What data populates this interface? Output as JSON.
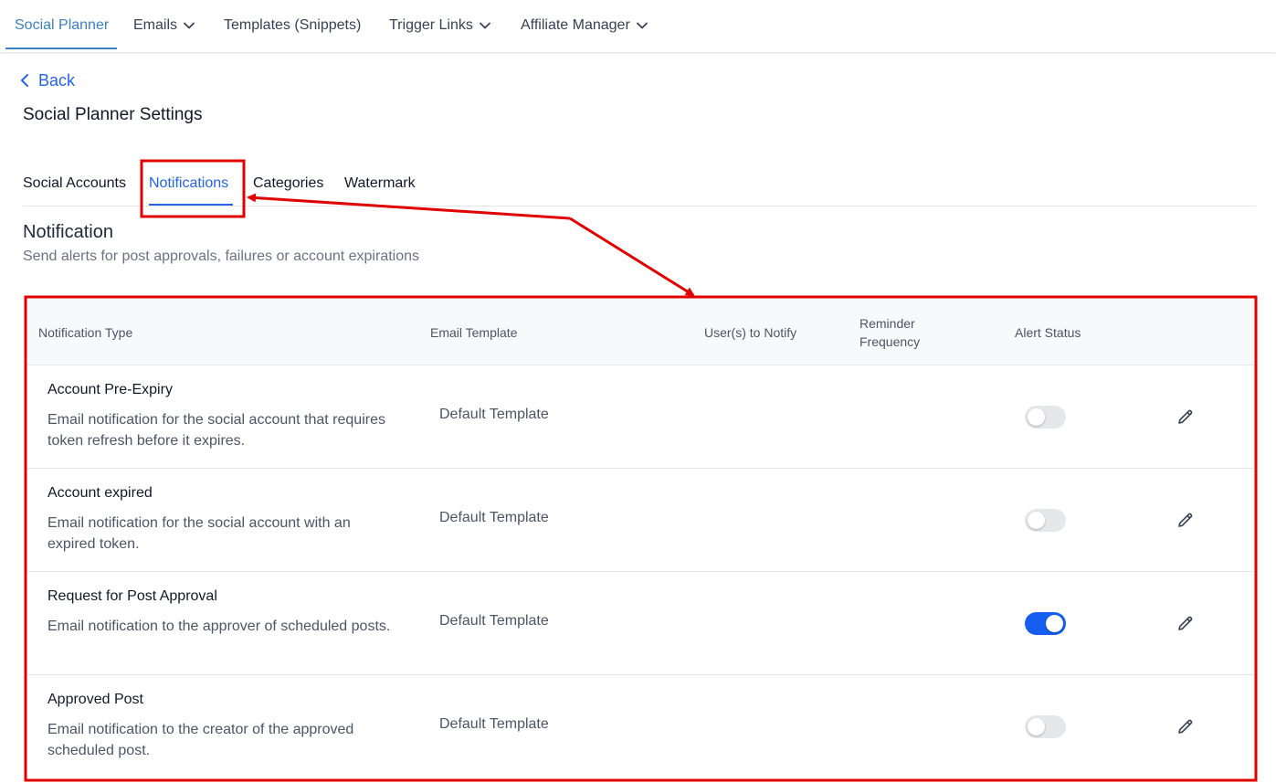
{
  "topnav": {
    "items": [
      {
        "label": "Social Planner",
        "active": true,
        "dropdown": false
      },
      {
        "label": "Emails",
        "active": false,
        "dropdown": true
      },
      {
        "label": "Templates (Snippets)",
        "active": false,
        "dropdown": false
      },
      {
        "label": "Trigger Links",
        "active": false,
        "dropdown": true
      },
      {
        "label": "Affiliate Manager",
        "active": false,
        "dropdown": true
      }
    ]
  },
  "back_label": "Back",
  "page_title": "Social Planner Settings",
  "tabs": [
    {
      "label": "Social Accounts",
      "active": false
    },
    {
      "label": "Notifications",
      "active": true
    },
    {
      "label": "Categories",
      "active": false
    },
    {
      "label": "Watermark",
      "active": false
    }
  ],
  "section": {
    "title": "Notification",
    "subtitle": "Send alerts for post approvals, failures or account expirations"
  },
  "table": {
    "columns": [
      "Notification Type",
      "Email Template",
      "User(s) to Notify",
      "Reminder Frequency",
      "Alert Status"
    ],
    "rows": [
      {
        "title": "Account Pre-Expiry",
        "description": "Email notification for the social account that requires token refresh before it expires.",
        "template": "Default Template",
        "alert_on": false
      },
      {
        "title": "Account expired",
        "description": "Email notification for the social account with an expired token.",
        "template": "Default Template",
        "alert_on": false
      },
      {
        "title": "Request for Post Approval",
        "description": "Email notification to the approver of scheduled posts.",
        "template": "Default Template",
        "alert_on": true
      },
      {
        "title": "Approved Post",
        "description": "Email notification to the creator of the approved scheduled post.",
        "template": "Default Template",
        "alert_on": false
      }
    ]
  },
  "colors": {
    "nav_active": "#3b82c4",
    "link": "#2563eb",
    "toggle_on": "#155eef",
    "annotation": "#e00000"
  },
  "icons": [
    "chevron-down-icon",
    "chevron-left-icon",
    "pencil-icon"
  ]
}
